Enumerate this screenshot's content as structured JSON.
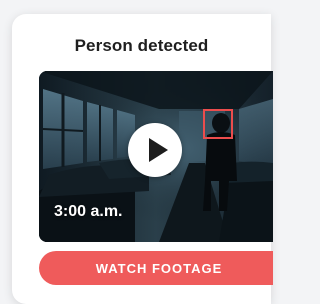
{
  "card": {
    "title": "Person detected",
    "video": {
      "timestamp": "3:00 a.m.",
      "play_icon": "play-icon"
    },
    "button_label": "WATCH FOOTAGE"
  },
  "colors": {
    "accent": "#ef5b5b",
    "detection_box": "#ec4d4d",
    "title_text": "#1f1f1f",
    "card_bg": "#ffffff"
  }
}
